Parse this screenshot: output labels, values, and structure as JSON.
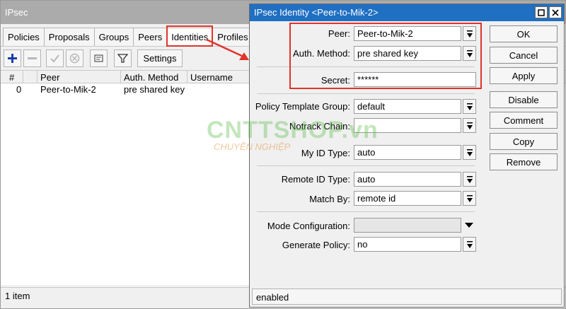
{
  "back_window": {
    "title": "IPsec",
    "tabs": [
      "Policies",
      "Proposals",
      "Groups",
      "Peers",
      "Identities",
      "Profiles"
    ],
    "active_tab": "Identities",
    "toolbar": {
      "settings_label": "Settings"
    },
    "columns": [
      "#",
      "Peer",
      "Auth. Method",
      "Username"
    ],
    "rows": [
      {
        "index": "0",
        "peer": "Peer-to-Mik-2",
        "auth_method": "pre shared key",
        "username": ""
      }
    ],
    "status": "1 item"
  },
  "dialog": {
    "title": "IPsec Identity <Peer-to-Mik-2>",
    "fields": {
      "peer": {
        "label": "Peer:",
        "value": "Peer-to-Mik-2"
      },
      "auth_method": {
        "label": "Auth. Method:",
        "value": "pre shared key"
      },
      "secret": {
        "label": "Secret:",
        "value": "******"
      },
      "policy_template_group": {
        "label": "Policy Template Group:",
        "value": "default"
      },
      "notrack_chain": {
        "label": "Notrack Chain:",
        "value": ""
      },
      "my_id_type": {
        "label": "My ID Type:",
        "value": "auto"
      },
      "remote_id_type": {
        "label": "Remote ID Type:",
        "value": "auto"
      },
      "match_by": {
        "label": "Match By:",
        "value": "remote id"
      },
      "mode_configuration": {
        "label": "Mode Configuration:",
        "value": ""
      },
      "generate_policy": {
        "label": "Generate Policy:",
        "value": "no"
      }
    },
    "buttons": {
      "ok": "OK",
      "cancel": "Cancel",
      "apply": "Apply",
      "disable": "Disable",
      "comment": "Comment",
      "copy": "Copy",
      "remove": "Remove"
    },
    "status": "enabled"
  },
  "watermark": {
    "main": "CNTTSHOP.vn",
    "sub": "CHUYÊN NGHIỆP"
  },
  "colors": {
    "highlight": "#e0342a",
    "title_bar": "#1f6fc2",
    "back_title_bar": "#ababab",
    "add_icon": "#1a3fa8"
  }
}
